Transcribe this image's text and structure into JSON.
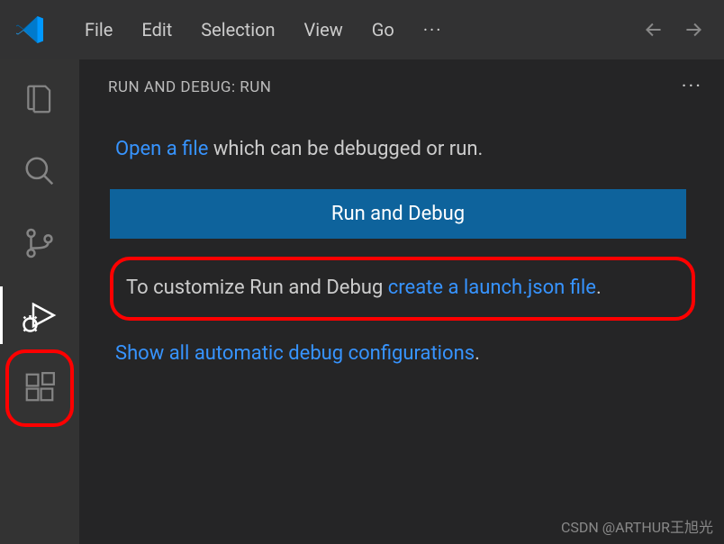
{
  "menu": {
    "file": "File",
    "edit": "Edit",
    "selection": "Selection",
    "view": "View",
    "go": "Go",
    "more": "···"
  },
  "sidebar": {
    "title": "RUN AND DEBUG: RUN",
    "more": "···"
  },
  "panel": {
    "open_file_link": "Open a file",
    "open_file_rest": " which can be debugged or run.",
    "run_button": "Run and Debug",
    "customize_pre": "To customize Run and Debug ",
    "customize_link": "create a launch.json file",
    "customize_post": ".",
    "show_all_link": "Show all automatic debug configurations",
    "show_all_post": "."
  },
  "watermark": "CSDN @ARTHUR王旭光"
}
